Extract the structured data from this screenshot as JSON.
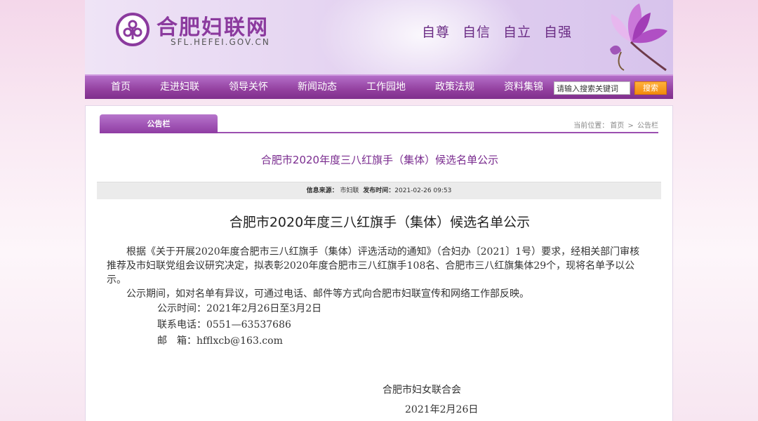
{
  "header": {
    "site_name": "合肥妇联网",
    "site_domain": "SFL.HEFEI.GOV.CN",
    "slogans": [
      "自尊",
      "自信",
      "自立",
      "自强"
    ]
  },
  "nav": {
    "items": [
      "首页",
      "走进妇联",
      "领导关怀",
      "新闻动态",
      "工作园地",
      "政策法规",
      "资料集锦"
    ],
    "search_placeholder": "请输入搜索关键词",
    "search_button": "搜索"
  },
  "content": {
    "tab_label": "公告栏",
    "breadcrumb": {
      "prefix": "当前位置：",
      "home": "首页",
      "sep": ">",
      "current": "公告栏"
    },
    "title": "合肥市2020年度三八红旗手（集体）候选名单公示",
    "info": {
      "source_label": "信息来源：",
      "source": "市妇联",
      "time_label": "发布时间：",
      "time": "2021-02-26 09:53"
    },
    "article_title": "合肥市2020年度三八红旗手（集体）候选名单公示",
    "paragraph1": "根据《关于开展2020年度合肥市三八红旗手（集体）评选活动的通知》（合妇办〔2021〕1号）要求，经相关部门审核推荐及市妇联党组会议研究决定，拟表彰2020年度合肥市三八红旗手108名、合肥市三八红旗集体29个，现将名单予以公示。",
    "paragraph2": "公示期间，如对名单有异议，可通过电话、邮件等方式向合肥市妇联宣传和网络工作部反映。",
    "period": "公示时间：2021年2月26日至3月2日",
    "phone": "联系电话：0551—63537686",
    "email": "邮　箱：hfflxcb@163.com",
    "signature": "合肥市妇女联合会",
    "date": "2021年2月26日"
  }
}
